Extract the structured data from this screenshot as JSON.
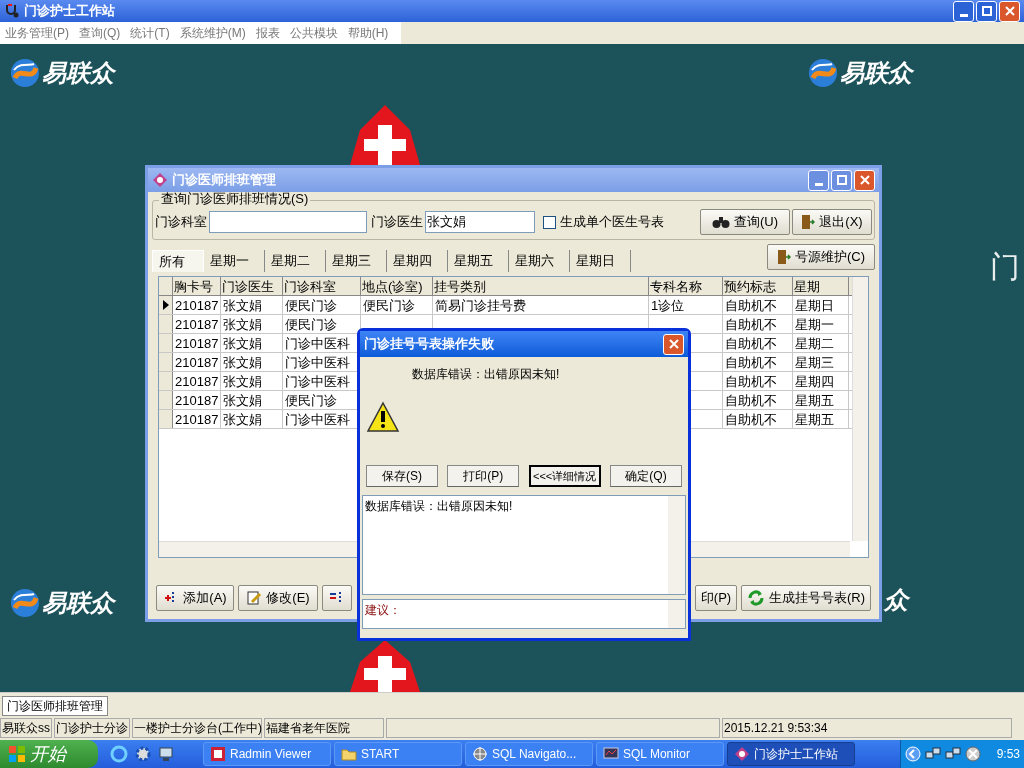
{
  "app_window": {
    "title": "门诊护士工作站"
  },
  "menu": [
    "业务管理(P)",
    "查询(Q)",
    "统计(T)",
    "系统维护(M)",
    "报表",
    "公共模块",
    "帮助(H)"
  ],
  "desktop": {
    "logos": [
      "易联众",
      "易联众",
      "易联众",
      "众"
    ],
    "bg_text": "门"
  },
  "schedule_window": {
    "title": "门诊医师排班管理",
    "query_group": {
      "title": "查询门诊医师排班情况(S)",
      "dept_label": "门诊科室",
      "doctor_label": "门诊医生",
      "doctor_value": "张文娟",
      "single_checkbox": {
        "label": "生成单个医生号表",
        "checked": false
      },
      "query_button": "查询(U)",
      "exit_button": "退出(X)"
    },
    "tabs": [
      {
        "label": "所有",
        "selected": true
      },
      {
        "label": "星期一",
        "selected": false
      },
      {
        "label": "星期二",
        "selected": false
      },
      {
        "label": "星期三",
        "selected": false
      },
      {
        "label": "星期四",
        "selected": false
      },
      {
        "label": "星期五",
        "selected": false
      },
      {
        "label": "星期六",
        "selected": false
      },
      {
        "label": "星期日",
        "selected": false
      }
    ],
    "source_button": "号源维护(C)",
    "table": {
      "columns": [
        "胸卡号",
        "门诊医生",
        "门诊科室",
        "地点(诊室)",
        "挂号类别",
        "专科名称",
        "预约标志",
        "星期"
      ],
      "rows": [
        {
          "selected": true,
          "card": "210187",
          "doctor": "张文娟",
          "dept": "便民门诊",
          "location": "便民门诊",
          "reg_type": "简易门诊挂号费",
          "specialty": "1诊位",
          "booking": "自助机不",
          "weekday": "星期日"
        },
        {
          "selected": false,
          "card": "210187",
          "doctor": "张文娟",
          "dept": "便民门诊",
          "booking": "自助机不",
          "weekday": "星期一"
        },
        {
          "selected": false,
          "card": "210187",
          "doctor": "张文娟",
          "dept": "门诊中医科",
          "booking": "自助机不",
          "weekday": "星期二"
        },
        {
          "selected": false,
          "card": "210187",
          "doctor": "张文娟",
          "dept": "门诊中医科",
          "booking": "自助机不",
          "weekday": "星期三"
        },
        {
          "selected": false,
          "card": "210187",
          "doctor": "张文娟",
          "dept": "门诊中医科",
          "booking": "自助机不",
          "weekday": "星期四"
        },
        {
          "selected": false,
          "card": "210187",
          "doctor": "张文娟",
          "dept": "便民门诊",
          "booking": "自助机不",
          "weekday": "星期五"
        },
        {
          "selected": false,
          "card": "210187",
          "doctor": "张文娟",
          "dept": "门诊中医科",
          "booking": "自助机不",
          "weekday": "星期五"
        }
      ]
    },
    "buttons": [
      {
        "kind": "add",
        "label": "添加(A)"
      },
      {
        "kind": "edit",
        "label": "修改(E)"
      },
      {
        "kind": "delete"
      },
      {
        "kind": "print",
        "label": "印(P)"
      },
      {
        "kind": "generate",
        "label": "生成挂号号表(R)"
      }
    ]
  },
  "error_dialog": {
    "title": "门诊挂号号表操作失败",
    "message": "数据库错误：出错原因未知!",
    "buttons": [
      {
        "label": "保存(S)",
        "focused": false
      },
      {
        "label": "打印(P)",
        "focused": false
      },
      {
        "label": "<<<详细情况",
        "focused": true
      },
      {
        "label": "确定(Q)",
        "focused": false
      }
    ],
    "details": "数据库错误：出错原因未知!",
    "suggestion_label": "建议："
  },
  "window_tabs": [
    "门诊医师排班管理"
  ],
  "status_bar": [
    "易联众ss",
    "门诊护士分诊",
    "一楼护士分诊台(工作中)",
    "福建省老年医院",
    "2015.12.21 9:53:34"
  ],
  "taskbar": {
    "start": "开始",
    "tasks": [
      {
        "label": "Radmin Viewer",
        "kind": "radmin",
        "active": false
      },
      {
        "label": "START",
        "kind": "folder",
        "active": false
      },
      {
        "label": "SQL Navigato...",
        "kind": "navigator",
        "active": false
      },
      {
        "label": "SQL Monitor",
        "kind": "monitor",
        "active": false
      },
      {
        "label": "门诊护士工作站",
        "kind": "app",
        "active": true
      }
    ],
    "clock": "9:53"
  }
}
